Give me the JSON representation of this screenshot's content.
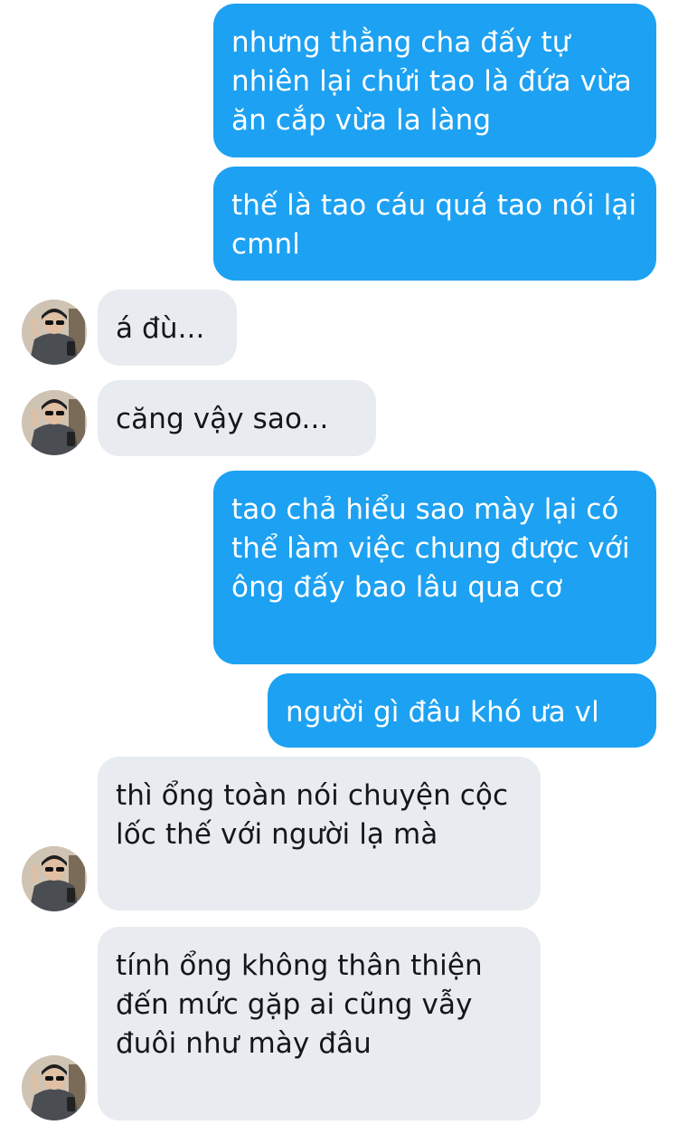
{
  "conversation": {
    "messages": [
      {
        "direction": "outgoing",
        "text": "nhưng thằng cha đấy tự nhiên lại chửi tao là đứa vừa ăn cắp vừa la làng"
      },
      {
        "direction": "outgoing",
        "text": "thế là tao cáu quá tao nói lại cmnl"
      },
      {
        "direction": "incoming",
        "text": "á đù..."
      },
      {
        "direction": "incoming",
        "text": "căng vậy sao..."
      },
      {
        "direction": "outgoing",
        "text": "tao chả hiểu sao mày lại có thể làm việc chung được với ông đấy bao lâu qua cơ"
      },
      {
        "direction": "outgoing",
        "text": "người gì đâu khó ưa vl"
      },
      {
        "direction": "incoming",
        "text": "thì ổng toàn nói chuyện cộc lốc thế với người lạ mà"
      },
      {
        "direction": "incoming",
        "text": "tính ổng không thân thiện đến mức gặp ai cũng vẫy đuôi như mày đâu"
      }
    ]
  },
  "colors": {
    "outgoing_bubble": "#1da1f2",
    "incoming_bubble": "#e8ebef",
    "outgoing_text": "#ffffff",
    "incoming_text": "#14171a"
  }
}
